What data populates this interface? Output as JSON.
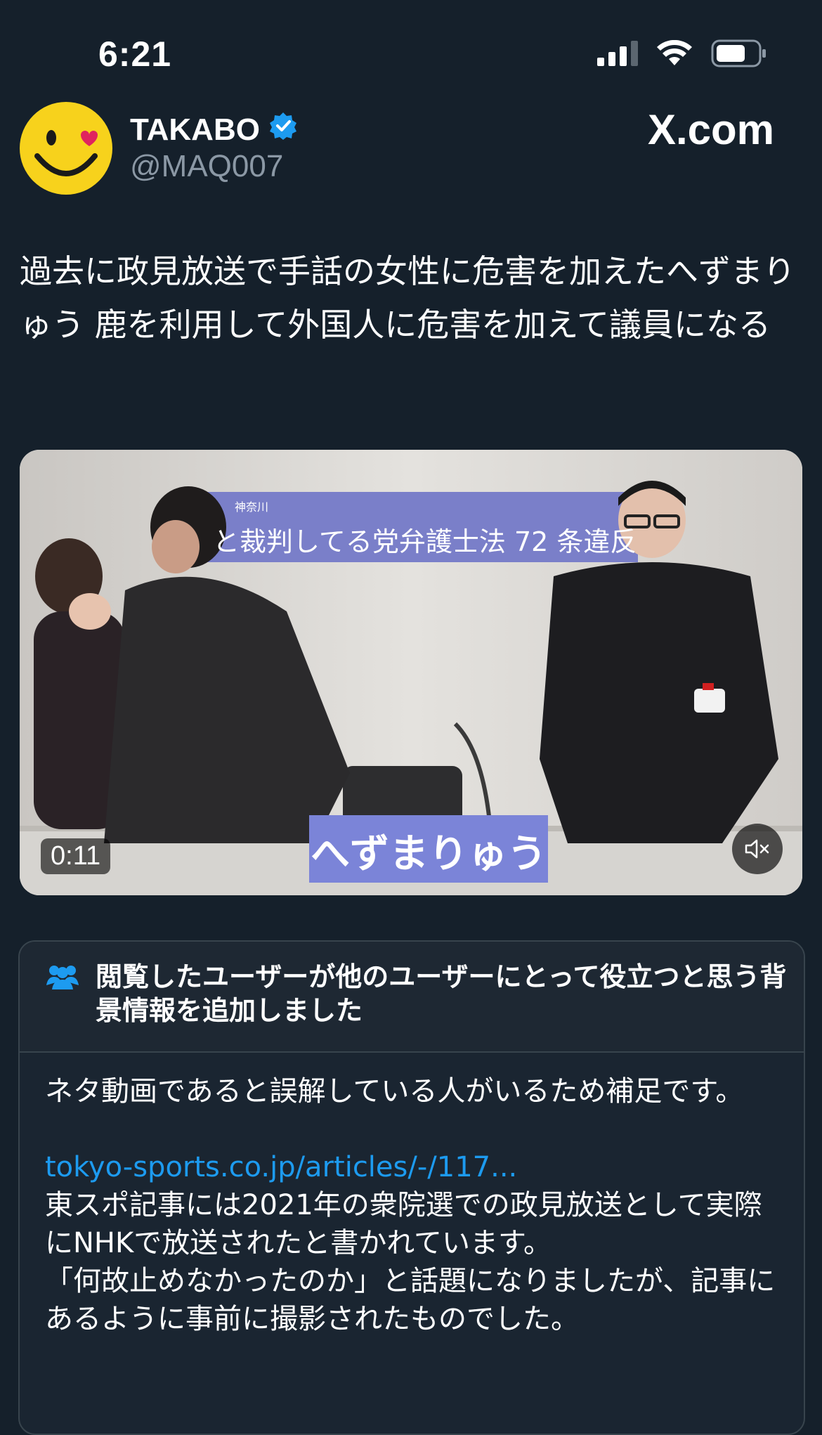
{
  "status_bar": {
    "time": "6:21"
  },
  "post": {
    "display_name": "TAKABO",
    "handle": "@MAQ007",
    "site": "X.com",
    "text": "過去に政見放送で手話の女性に危害を加えたへずまりゅう 鹿を利用して外国人に危害を加えて議員になる"
  },
  "media": {
    "banner_small": "神奈川",
    "banner_text": "と裁判してる党弁護士法 72 条違反",
    "nameplate": "へずまりゅう",
    "duration": "0:11"
  },
  "community_note": {
    "title": "閲覧したユーザーが他のユーザーにとって役立つと思う背景情報を追加しました",
    "intro": "ネタ動画であると誤解している人がいるため補足です。",
    "link": "tokyo-sports.co.jp/articles/-/117...",
    "body_1": "東スポ記事には2021年の衆院選での政見放送として実際にNHKで放送されたと書かれています。",
    "body_2": "「何故止めなかったのか」と話題になりましたが、記事にあるように事前に撮影されたものでした。"
  },
  "colors": {
    "background": "#15202b",
    "link": "#1d9bf0",
    "verified": "#1d9bf0",
    "secondary_text": "#8b98a5"
  }
}
